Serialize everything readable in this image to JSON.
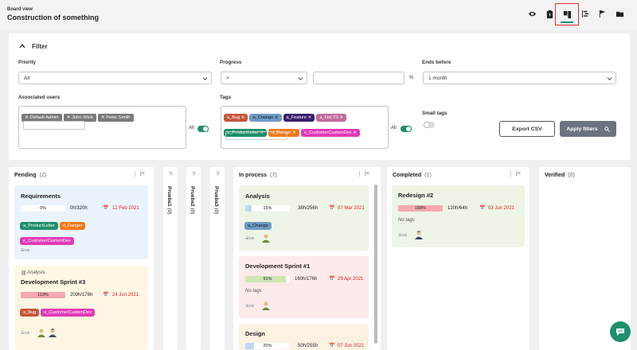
{
  "header": {
    "subtitle": "Board view",
    "title": "Construction of something"
  },
  "toolbar": {
    "icons": [
      "eye-icon",
      "clipboard-icon",
      "board-icon",
      "gantt-icon",
      "flag-icon",
      "folder-icon"
    ],
    "active": "board-icon"
  },
  "filter": {
    "heading": "Filter",
    "priority": {
      "label": "Priority",
      "value": "All"
    },
    "progress": {
      "label": "Progress",
      "operator": ">",
      "value": "",
      "unit": "%"
    },
    "ends_before": {
      "label": "Ends before",
      "value": "1 month"
    },
    "associated_users": {
      "label": "Associated users",
      "chips": [
        "Default Admin",
        "John Wick",
        "Peter Smith"
      ],
      "all_label": "All"
    },
    "tags": {
      "label": "Tags",
      "chips": [
        {
          "text": "a_Bug",
          "color": "#c9563b"
        },
        {
          "text": "a_Change",
          "color": "#6f9bc7"
        },
        {
          "text": "a_Feature",
          "color": "#3b1f6b"
        },
        {
          "text": "a_FixLTS",
          "color": "#c36b9d"
        },
        {
          "text": "a_ProductLetter",
          "color": "#1f8f6d"
        },
        {
          "text": "d_Danger",
          "color": "#f07a1a"
        },
        {
          "text": "e_CustomerCustomDev",
          "color": "#e23ab8"
        }
      ],
      "all_label": "All"
    },
    "small_tags": {
      "label": "Small tags"
    },
    "export_label": "Export CSV",
    "apply_label": "Apply filters"
  },
  "columns": {
    "pending": {
      "title": "Pending",
      "count": "(2)"
    },
    "prueba1": {
      "title": "Prueba1",
      "count": "(0)"
    },
    "prueba2": {
      "title": "Prueba2",
      "count": "(0)"
    },
    "prueba3": {
      "title": "Prueba3",
      "count": "(0)"
    },
    "in_process": {
      "title": "In process",
      "count": "(7)"
    },
    "completed": {
      "title": "Completed",
      "count": "(1)"
    },
    "verified": {
      "title": "Verified",
      "count": "(0)"
    }
  },
  "cards": {
    "requirements": {
      "title": "Requirements",
      "progress": "0%",
      "progress_value": 0,
      "hours": "0h/320h",
      "due": "12 Feb 2021",
      "tags": [
        {
          "text": "a_ProductLetter",
          "color": "#1f8f6d"
        },
        {
          "text": "d_Danger",
          "color": "#f07a1a"
        },
        {
          "text": "e_CustomerCustomDev",
          "color": "#e23ab8"
        }
      ]
    },
    "devsprint3": {
      "parent": "Analysis",
      "title": "Development Sprint #3",
      "progress": "119%",
      "progress_value": 119,
      "hours": "209h/176h",
      "due": "24 Jun 2021",
      "tags": [
        {
          "text": "a_Bug",
          "color": "#c9563b"
        },
        {
          "text": "e_CustomerCustomDev",
          "color": "#e23ab8"
        }
      ]
    },
    "analysis": {
      "title": "Analysis",
      "progress": "15%",
      "progress_value": 15,
      "hours": "38h/256h",
      "due": "07 Mar 2021",
      "tags": [
        {
          "text": "a_Change",
          "color": "#6f9bc7"
        }
      ]
    },
    "devsprint1": {
      "title": "Development Sprint #1",
      "progress": "91%",
      "progress_value": 91,
      "hours": "160h/176h",
      "due": "29 Apr 2021",
      "no_tags": "No tags"
    },
    "design": {
      "title": "Design",
      "progress": "20%",
      "progress_value": 20,
      "hours": "50h/255h",
      "due": "07 Jun 2021"
    },
    "redesign2": {
      "title": "Redesign #2",
      "progress": "188%",
      "progress_value": 188,
      "hours": "120h/64h",
      "due": "03 Jun 2021",
      "no_tags": "No tags"
    }
  }
}
